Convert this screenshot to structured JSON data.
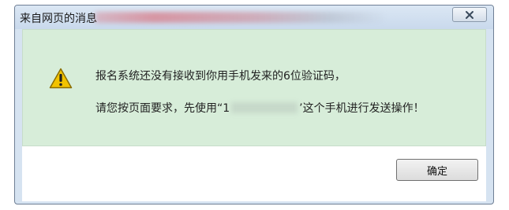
{
  "dialog": {
    "title": "来自网页的消息",
    "message_line1": "报名系统还没有接收到你用手机发来的6位验证码，",
    "message_line2_prefix": "请您按页面要求，先使用“1",
    "message_line2_suffix": "’这个手机进行发送操作！",
    "ok_label": "确定",
    "icons": {
      "close": "close-icon",
      "warning": "warning-icon"
    },
    "colors": {
      "content_bg": "#d7edd9",
      "frame": "#d6e3f1",
      "warning_yellow": "#f2c300"
    }
  }
}
